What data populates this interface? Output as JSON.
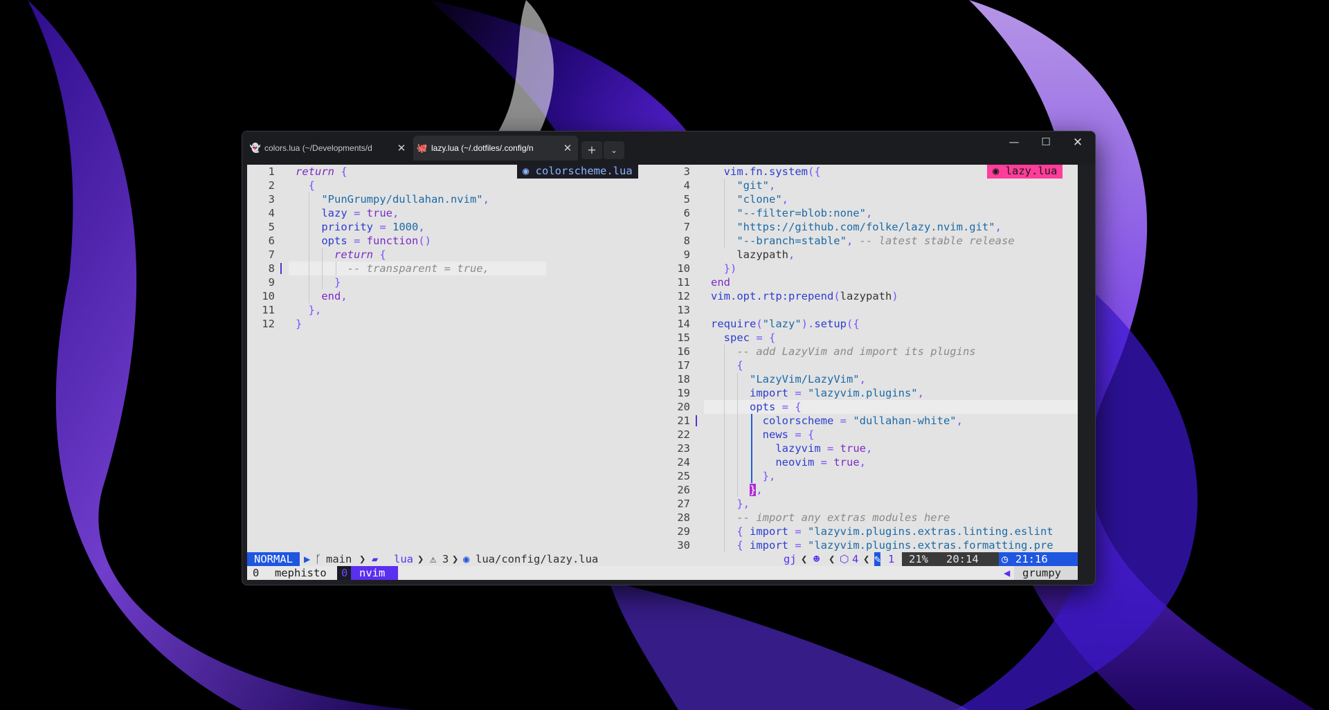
{
  "tabs": [
    {
      "title": "colors.lua (~/Developments/d",
      "icon": "ghost-icon",
      "close": "✕"
    },
    {
      "title": "lazy.lua (~/.dotfiles/.config/n",
      "icon": "octopus-icon",
      "close": "✕"
    }
  ],
  "tabbar": {
    "new_tab": "+",
    "dropdown": "⌄"
  },
  "window_controls": {
    "minimize": "—",
    "maximize": "☐",
    "close": "✕"
  },
  "left_pane": {
    "badge": "colorscheme.lua",
    "lines": [
      {
        "n": "1",
        "code": [
          [
            "ki",
            "return "
          ],
          [
            "p",
            "{"
          ]
        ]
      },
      {
        "n": "2",
        "code": [
          [
            "v",
            "  "
          ],
          [
            "p",
            "{"
          ]
        ]
      },
      {
        "n": "3",
        "code": [
          [
            "v",
            "    "
          ],
          [
            "s",
            "\"PunGrumpy/dullahan.nvim\""
          ],
          [
            "p",
            ","
          ]
        ]
      },
      {
        "n": "4",
        "code": [
          [
            "v",
            "    "
          ],
          [
            "t",
            "lazy"
          ],
          [
            "p",
            " = "
          ],
          [
            "k",
            "true"
          ],
          [
            "p",
            ","
          ]
        ]
      },
      {
        "n": "5",
        "code": [
          [
            "v",
            "    "
          ],
          [
            "t",
            "priority"
          ],
          [
            "p",
            " = "
          ],
          [
            "n",
            "1000"
          ],
          [
            "p",
            ","
          ]
        ]
      },
      {
        "n": "6",
        "code": [
          [
            "v",
            "    "
          ],
          [
            "t",
            "opts"
          ],
          [
            "p",
            " = "
          ],
          [
            "f",
            "function"
          ],
          [
            "p",
            "()"
          ]
        ]
      },
      {
        "n": "7",
        "code": [
          [
            "v",
            "      "
          ],
          [
            "ki",
            "return "
          ],
          [
            "p",
            "{"
          ]
        ]
      },
      {
        "n": "8",
        "code": [
          [
            "v",
            "        "
          ],
          [
            "c",
            "-- transparent = true,"
          ]
        ],
        "cursor": true
      },
      {
        "n": "9",
        "code": [
          [
            "v",
            "      "
          ],
          [
            "p",
            "}"
          ]
        ]
      },
      {
        "n": "10",
        "code": [
          [
            "v",
            "    "
          ],
          [
            "k",
            "end"
          ],
          [
            "p",
            ","
          ]
        ]
      },
      {
        "n": "11",
        "code": [
          [
            "v",
            "  "
          ],
          [
            "p",
            "},"
          ]
        ]
      },
      {
        "n": "12",
        "code": [
          [
            "p",
            "}"
          ]
        ]
      }
    ]
  },
  "right_pane": {
    "badge": "lazy.lua",
    "lines": [
      {
        "n": "3",
        "code": [
          [
            "v",
            "  "
          ],
          [
            "t",
            "vim.fn.system"
          ],
          [
            "p",
            "({"
          ]
        ]
      },
      {
        "n": "4",
        "code": [
          [
            "v",
            "    "
          ],
          [
            "s",
            "\"git\""
          ],
          [
            "p",
            ","
          ]
        ]
      },
      {
        "n": "5",
        "code": [
          [
            "v",
            "    "
          ],
          [
            "s",
            "\"clone\""
          ],
          [
            "p",
            ","
          ]
        ]
      },
      {
        "n": "6",
        "code": [
          [
            "v",
            "    "
          ],
          [
            "s",
            "\"--filter=blob:none\""
          ],
          [
            "p",
            ","
          ]
        ]
      },
      {
        "n": "7",
        "code": [
          [
            "v",
            "    "
          ],
          [
            "s",
            "\"https://github.com/folke/lazy.nvim.git\""
          ],
          [
            "p",
            ","
          ]
        ]
      },
      {
        "n": "8",
        "code": [
          [
            "v",
            "    "
          ],
          [
            "s",
            "\"--branch=stable\""
          ],
          [
            "p",
            ", "
          ],
          [
            "c",
            "-- latest stable release"
          ]
        ]
      },
      {
        "n": "9",
        "code": [
          [
            "v",
            "    lazypath"
          ],
          [
            "p",
            ","
          ]
        ]
      },
      {
        "n": "10",
        "code": [
          [
            "v",
            "  "
          ],
          [
            "p",
            "})"
          ]
        ]
      },
      {
        "n": "11",
        "code": [
          [
            "k",
            "end"
          ]
        ]
      },
      {
        "n": "12",
        "code": [
          [
            "t",
            "vim.opt.rtp:prepend"
          ],
          [
            "p",
            "("
          ],
          [
            "v",
            "lazypath"
          ],
          [
            "p",
            ")"
          ]
        ]
      },
      {
        "n": "13",
        "code": []
      },
      {
        "n": "14",
        "code": [
          [
            "t",
            "require"
          ],
          [
            "p",
            "("
          ],
          [
            "s",
            "\"lazy\""
          ],
          [
            "p",
            ")."
          ],
          [
            "t",
            "setup"
          ],
          [
            "p",
            "({"
          ]
        ]
      },
      {
        "n": "15",
        "code": [
          [
            "v",
            "  "
          ],
          [
            "t",
            "spec"
          ],
          [
            "p",
            " = {"
          ]
        ]
      },
      {
        "n": "16",
        "code": [
          [
            "v",
            "    "
          ],
          [
            "c",
            "-- add LazyVim and import its plugins"
          ]
        ]
      },
      {
        "n": "17",
        "code": [
          [
            "v",
            "    "
          ],
          [
            "p",
            "{"
          ]
        ]
      },
      {
        "n": "18",
        "code": [
          [
            "v",
            "      "
          ],
          [
            "s",
            "\"LazyVim/LazyVim\""
          ],
          [
            "p",
            ","
          ]
        ]
      },
      {
        "n": "19",
        "code": [
          [
            "v",
            "      "
          ],
          [
            "t",
            "import"
          ],
          [
            "p",
            " = "
          ],
          [
            "s",
            "\"lazyvim.plugins\""
          ],
          [
            "p",
            ","
          ]
        ]
      },
      {
        "n": "20",
        "code": [
          [
            "v",
            "      "
          ],
          [
            "t",
            "opts"
          ],
          [
            "p",
            " = {"
          ]
        ],
        "cursor": true
      },
      {
        "n": "21",
        "code": [
          [
            "v",
            "        "
          ],
          [
            "t",
            "colorscheme"
          ],
          [
            "p",
            " = "
          ],
          [
            "s",
            "\"dullahan-white\""
          ],
          [
            "p",
            ","
          ]
        ],
        "mark": true
      },
      {
        "n": "22",
        "code": [
          [
            "v",
            "        "
          ],
          [
            "t",
            "news"
          ],
          [
            "p",
            " = {"
          ]
        ]
      },
      {
        "n": "23",
        "code": [
          [
            "v",
            "          "
          ],
          [
            "t",
            "lazyvim"
          ],
          [
            "p",
            " = "
          ],
          [
            "k",
            "true"
          ],
          [
            "p",
            ","
          ]
        ]
      },
      {
        "n": "24",
        "code": [
          [
            "v",
            "          "
          ],
          [
            "t",
            "neovim"
          ],
          [
            "p",
            " = "
          ],
          [
            "k",
            "true"
          ],
          [
            "p",
            ","
          ]
        ]
      },
      {
        "n": "25",
        "code": [
          [
            "v",
            "        "
          ],
          [
            "p",
            "},"
          ]
        ]
      },
      {
        "n": "26",
        "code": [
          [
            "v",
            "      "
          ],
          [
            "br",
            "}"
          ],
          [
            "p",
            ","
          ]
        ]
      },
      {
        "n": "27",
        "code": [
          [
            "v",
            "    "
          ],
          [
            "p",
            "},"
          ]
        ]
      },
      {
        "n": "28",
        "code": [
          [
            "v",
            "    "
          ],
          [
            "c",
            "-- import any extras modules here"
          ]
        ]
      },
      {
        "n": "29",
        "code": [
          [
            "v",
            "    "
          ],
          [
            "p",
            "{ "
          ],
          [
            "t",
            "import"
          ],
          [
            "p",
            " = "
          ],
          [
            "s",
            "\"lazyvim.plugins.extras.linting.eslint"
          ]
        ]
      },
      {
        "n": "30",
        "code": [
          [
            "v",
            "    "
          ],
          [
            "p",
            "{ "
          ],
          [
            "t",
            "import"
          ],
          [
            "p",
            " = "
          ],
          [
            "s",
            "\"lazyvim.plugins.extras.formatting.pre"
          ]
        ]
      }
    ]
  },
  "statusline": {
    "mode": "NORMAL",
    "branch": "main",
    "dir": "lua",
    "warnings": "3",
    "file": "lua/config/lazy.lua",
    "keys": "gj",
    "plugins": "4",
    "count": "1",
    "percent": "21%",
    "position": "20:14",
    "time": "21:16"
  },
  "tmux": {
    "session_index": "0",
    "host": "mephisto",
    "window_index": "0",
    "window_name": "nvim",
    "user": "grumpy"
  },
  "colors": {
    "mode_bg": "#1f56e0",
    "accent": "#5b2ff0",
    "badge_right": "#ff3d9a"
  }
}
